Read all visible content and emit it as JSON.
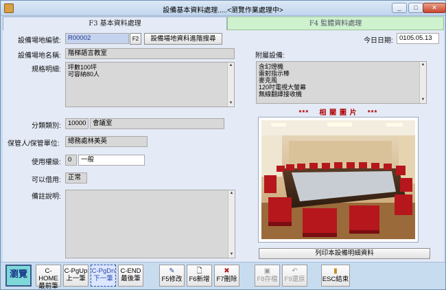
{
  "window": {
    "title": "設備基本資料處理.....<瀏覽作業處理中>",
    "min": "_",
    "max": "□",
    "close": "✕"
  },
  "tabs": {
    "basic": "F3 基本資料處理",
    "monitor": "F4 監體資料處理"
  },
  "form": {
    "venue_code_label": "設備場地編號:",
    "venue_code": "R00002",
    "f2_label": "F2",
    "advanced_search": "設備場地資料進階搜尋",
    "date_label": "今日日期:",
    "date": "0105.05.13",
    "venue_name_label": "設備場地名稱:",
    "venue_name": "階梯語言教室",
    "spec_label": "規格明細:",
    "spec_lines": [
      "坪數100坪",
      "可容納80人"
    ],
    "accessories_label": "附屬設備:",
    "accessories": [
      "含幻燈機",
      "雷射指示棒",
      "麥克風",
      "120吋電視大螢幕",
      "無線翻譯接收機"
    ],
    "category_label": "分類類別:",
    "category_code": "10000",
    "category_name": "會議室",
    "keeper_label": "保管人/保管單位:",
    "keeper": "總務處林美英",
    "level_label": "使用權級:",
    "level_code": "0",
    "level_name": "一般",
    "borrow_label": "可以借用:",
    "borrow": "正常",
    "notes_label": "備註說明:"
  },
  "photo": {
    "title": "***    相 關 圖 片    ***",
    "print_button": "列印本設備明細資料"
  },
  "toolbar": {
    "browse": "瀏覽",
    "home_top": "C-HOME",
    "home_bottom": "最前筆",
    "pgup_top": "C-PgUp",
    "pgup_bottom": "上一筆",
    "pgdn_top": "C-PgDn",
    "pgdn_bottom": "下一筆",
    "end_top": "C-END",
    "end_bottom": "最後筆",
    "edit": "F5修改",
    "add": "F6新增",
    "delete": "F7刪除",
    "save": "F8存檔",
    "restore": "F9還原",
    "exit": "ESC結束"
  }
}
